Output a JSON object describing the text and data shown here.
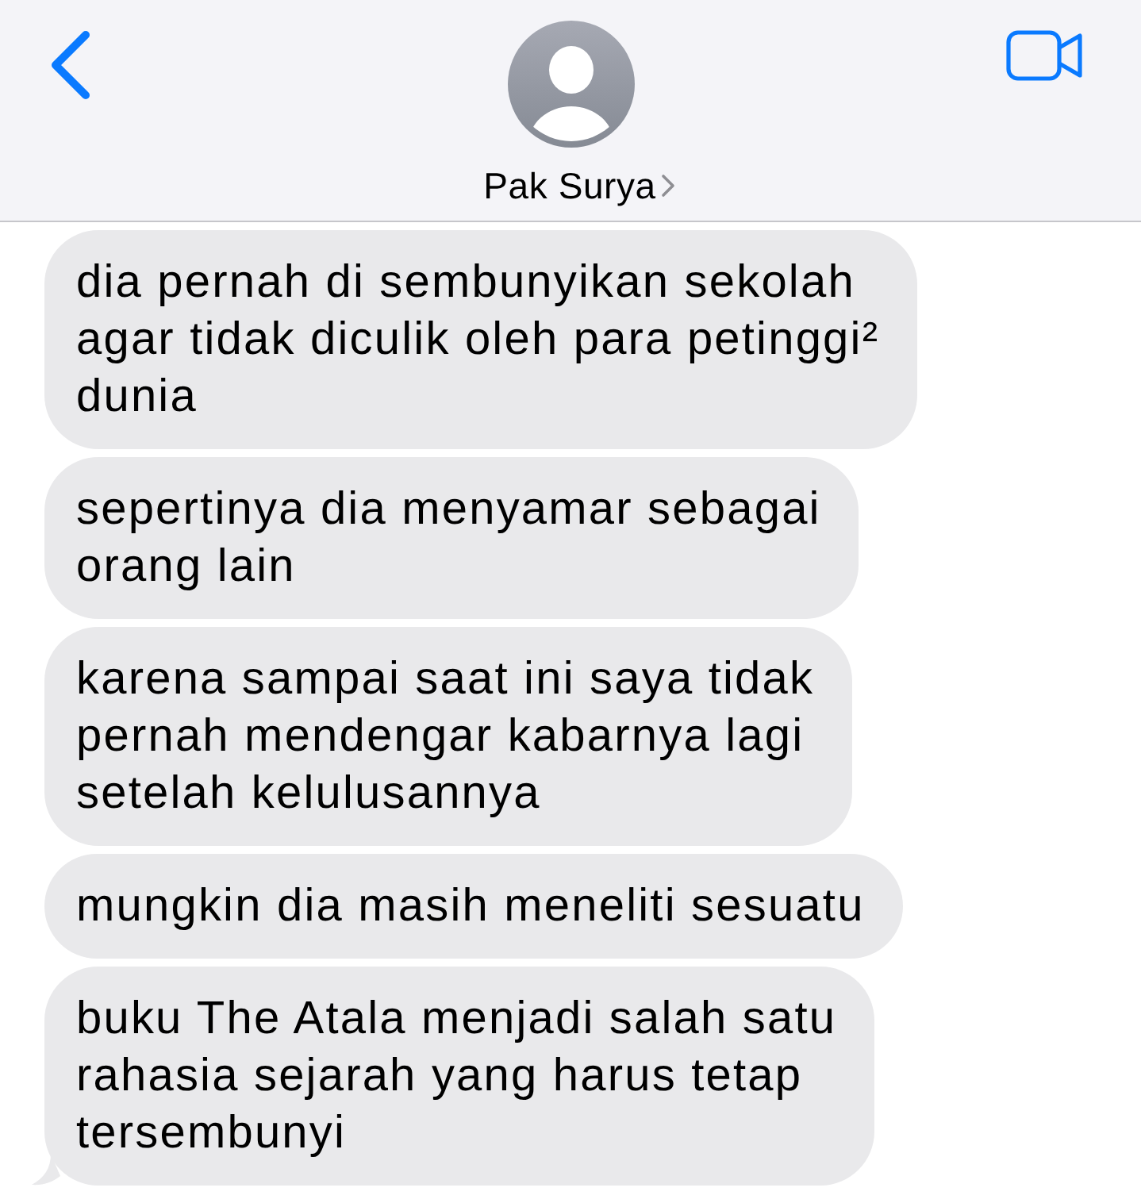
{
  "header": {
    "contact_name": "Pak Surya"
  },
  "messages": [
    {
      "text": "dia pernah di sembunyikan sekolah\nagar tidak diculik oleh para petinggi²\ndunia",
      "tail": false
    },
    {
      "text": "sepertinya dia menyamar sebagai\norang lain",
      "tail": false
    },
    {
      "text": "karena sampai saat ini saya tidak\npernah mendengar kabarnya lagi\nsetelah kelulusannya",
      "tail": false
    },
    {
      "text": "mungkin dia masih meneliti sesuatu",
      "tail": false
    },
    {
      "text": "buku The Atala menjadi salah satu\nrahasia sejarah yang harus tetap\ntersembunyi",
      "tail": true
    }
  ]
}
